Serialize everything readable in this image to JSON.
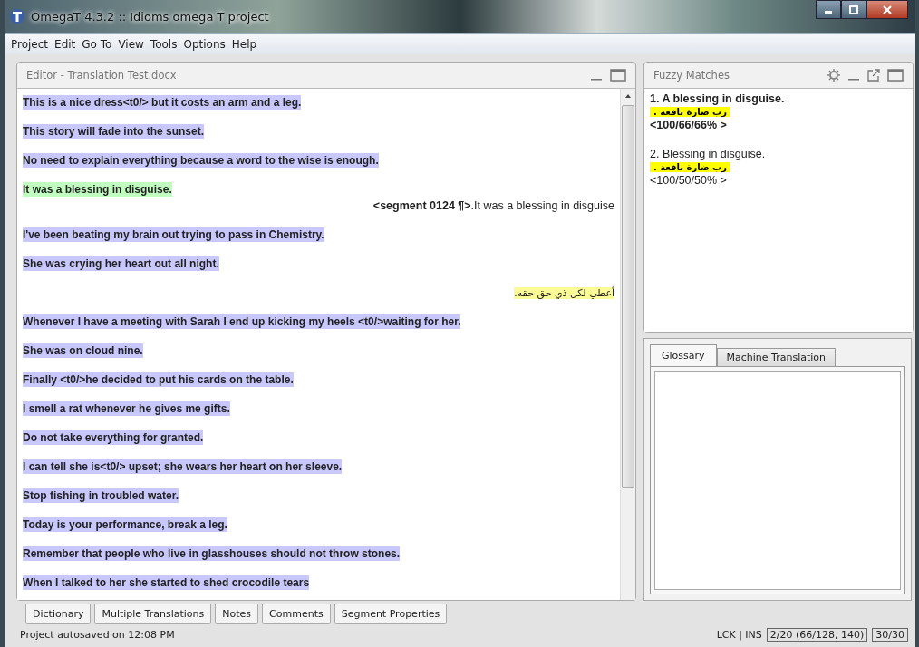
{
  "window": {
    "title": "OmegaT 4.3.2 :: Idioms omega T project"
  },
  "menu": [
    "Project",
    "Edit",
    "Go To",
    "View",
    "Tools",
    "Options",
    "Help"
  ],
  "editor": {
    "title": "Editor - Translation Test.docx",
    "rows": [
      {
        "kind": "source",
        "text": "This is a nice dress<t0/> but it costs an arm and a leg.",
        "selected": false
      },
      {
        "kind": "source",
        "text": "This story will fade into the sunset.",
        "selected": false
      },
      {
        "kind": "source",
        "text": "No need to explain everything because a word to the wise is enough.",
        "selected": false
      },
      {
        "kind": "source",
        "text": "It was a blessing in disguise.",
        "selected": true
      },
      {
        "kind": "editor",
        "tag": "<segment 0124 ¶>",
        "text": ".It was a blessing in disguise"
      },
      {
        "kind": "source",
        "text": "I've been beating my brain out trying to pass in Chemistry.",
        "selected": false
      },
      {
        "kind": "source",
        "text": "She was crying her heart out all night.",
        "selected": false
      },
      {
        "kind": "translation",
        "text": "أعطي لكل ذي حق حقه."
      },
      {
        "kind": "source",
        "text": "Whenever I have a meeting with Sarah I end up kicking my heels <t0/>waiting for her.",
        "selected": false
      },
      {
        "kind": "source",
        "text": "She was on cloud nine.",
        "selected": false
      },
      {
        "kind": "source",
        "text": "Finally <t0/>he decided to put his cards on the table.",
        "selected": false
      },
      {
        "kind": "source",
        "text": "I smell a rat whenever he gives me gifts.",
        "selected": false
      },
      {
        "kind": "source",
        "text": "Do not take everything for granted.",
        "selected": false
      },
      {
        "kind": "source",
        "text": "I can tell she is<t0/> upset; she wears her heart on her sleeve.",
        "selected": false
      },
      {
        "kind": "source",
        "text": "Stop fishing in troubled water.",
        "selected": false
      },
      {
        "kind": "source",
        "text": "Today is your performance, break a leg.",
        "selected": false
      },
      {
        "kind": "source",
        "text": "Remember that people who live in glasshouses should not throw stones.",
        "selected": false
      },
      {
        "kind": "source",
        "text": "When I talked to her she started to shed crocodile tears",
        "selected": false
      }
    ]
  },
  "fuzzy_matches": {
    "title": "Fuzzy Matches",
    "matches": [
      {
        "source": "1. A blessing in disguise.",
        "target": "رب ضارة نافعة .",
        "score": "<100/66/66% >",
        "selected": true
      },
      {
        "source": "2. Blessing in disguise.",
        "target": "رب ضارة نافعة .",
        "score": "<100/50/50% >",
        "selected": false
      }
    ]
  },
  "side_tabs": [
    {
      "label": "Glossary",
      "selected": true
    },
    {
      "label": "Machine Translation",
      "selected": false
    }
  ],
  "bottom_tabs": [
    "Dictionary",
    "Multiple Translations",
    "Notes",
    "Comments",
    "Segment Properties"
  ],
  "status_bar": {
    "message": "Project autosaved on 12:08 PM",
    "mode": "LCK | INS",
    "progress": "2/20 (66/128, 140)",
    "count": "30/30"
  }
}
